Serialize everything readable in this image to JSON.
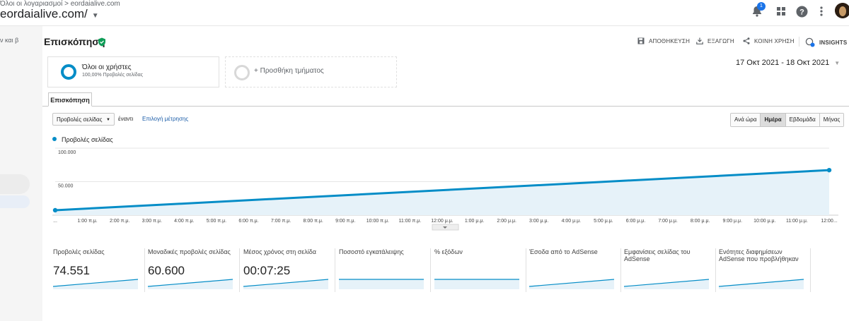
{
  "topbar": {
    "breadcrumb": "Όλοι οι λογαριασμοί > eordaialive.com",
    "property": "eordaialive.com/",
    "notification_count": "1"
  },
  "sidebar": {
    "label": "ν και β"
  },
  "header": {
    "title": "Επισκόπηση",
    "actions": {
      "save": "ΑΠΟΘΗΚΕΥΣΗ",
      "export": "ΕΞΑΓΩΓΗ",
      "share": "ΚΟΙΝΗ ΧΡΗΣΗ",
      "insights": "INSIGHTS"
    }
  },
  "segments": {
    "primary": {
      "name": "Όλοι οι χρήστες",
      "detail": "100,00% Προβολές σελίδας"
    },
    "add_label": "+ Προσθήκη τμήματος"
  },
  "date_range": "17 Οκτ 2021 - 18 Οκτ 2021",
  "tabs": {
    "overview": "Επισκόπηση"
  },
  "controls": {
    "metric_select": "Προβολές σελίδας",
    "versus": "έναντι",
    "choose_metric": "Επιλογή μέτρησης",
    "granularity": [
      "Ανά ώρα",
      "Ημέρα",
      "Εβδομάδα",
      "Μήνας"
    ],
    "active_granularity": "Ημέρα"
  },
  "colors": {
    "accent": "#058dc7",
    "fill": "#e6f2f9",
    "good": "#0f9d58"
  },
  "chart_data": {
    "type": "area",
    "legend": "Προβολές σελίδας",
    "y_ticks": [
      "100.000",
      "50.000"
    ],
    "ylim": [
      0,
      100000
    ],
    "x_labels": [
      "...",
      "1:00 π.μ.",
      "2:00 π.μ.",
      "3:00 π.μ.",
      "4:00 π.μ.",
      "5:00 π.μ.",
      "6:00 π.μ.",
      "7:00 π.μ.",
      "8:00 π.μ.",
      "9:00 π.μ.",
      "10:00 π.μ.",
      "11:00 π.μ.",
      "12:00 μ.μ.",
      "1:00 μ.μ.",
      "2:00 μ.μ.",
      "3:00 μ.μ.",
      "4:00 μ.μ.",
      "5:00 μ.μ.",
      "6:00 μ.μ.",
      "7:00 μ.μ.",
      "8:00 μ.μ.",
      "9:00 μ.μ.",
      "10:00 μ.μ.",
      "11:00 μ.μ.",
      "12:00..."
    ],
    "points": [
      {
        "x": "17 Οκτ 2021",
        "y": 7400
      },
      {
        "x": "18 Οκτ 2021",
        "y": 67200
      }
    ]
  },
  "metrics": [
    {
      "label": "Προβολές σελίδας",
      "value": "74.551"
    },
    {
      "label": "Μοναδικές προβολές σελίδας",
      "value": "60.600"
    },
    {
      "label": "Μέσος χρόνος στη σελίδα",
      "value": "00:07:25"
    },
    {
      "label": "Ποσοστό εγκατάλειψης",
      "value": ""
    },
    {
      "label": "% εξόδων",
      "value": ""
    },
    {
      "label": "Έσοδα από το AdSense",
      "value": ""
    },
    {
      "label": "Εμφανίσεις σελίδας του AdSense",
      "value": ""
    },
    {
      "label": "Ενότητες διαφημίσεων AdSense που προβλήθηκαν",
      "value": ""
    }
  ]
}
